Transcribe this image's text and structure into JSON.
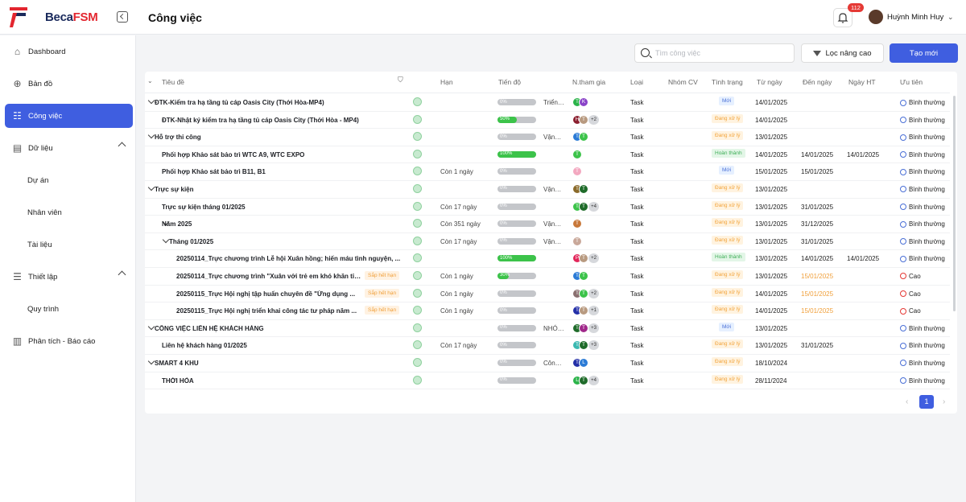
{
  "brand": {
    "name_a": "Beca",
    "name_b": "FSM"
  },
  "header": {
    "title": "Công việc",
    "notifications": "112",
    "user": "Huỳnh Minh Huy"
  },
  "sidebar": {
    "items": [
      {
        "label": "Dashboard"
      },
      {
        "label": "Bản đồ"
      },
      {
        "label": "Công việc"
      },
      {
        "label": "Dữ liệu"
      },
      {
        "label": "Dự án"
      },
      {
        "label": "Nhân viên"
      },
      {
        "label": "Tài liệu"
      },
      {
        "label": "Thiết lập"
      },
      {
        "label": "Quy trình"
      },
      {
        "label": "Phân tích - Báo cáo"
      }
    ]
  },
  "toolbar": {
    "search_placeholder": "Tìm công việc",
    "filter_label": "Lọc nâng cao",
    "create_label": "Tạo mới"
  },
  "table": {
    "headers": [
      "Tiêu đề",
      "Hạn",
      "Tiến độ",
      "N.tham gia",
      "Loại",
      "Nhóm CV",
      "Tình trạng",
      "Từ ngày",
      "Đến ngày",
      "Ngày HT",
      "Ưu tiên"
    ],
    "rows": [
      {
        "level": 0,
        "toggle": true,
        "title": "ĐTK-Kiểm tra hạ tầng tủ cáp Oasis City (Thới Hòa-MP4)",
        "due": "",
        "progress": 0,
        "progress_label": "0%",
        "extra": "Triển…",
        "avatars": [
          {
            "t": "T",
            "c": "#2bb34a"
          },
          {
            "t": "K",
            "c": "#8a44c8"
          }
        ],
        "more": "",
        "type": "Task",
        "status": "Mới",
        "status_kind": "new",
        "from": "14/01/2025",
        "to": "",
        "done": "",
        "priority": "Bình thường",
        "hi": false,
        "deadline": "",
        "late": false
      },
      {
        "level": 1,
        "toggle": false,
        "title": "ĐTK-Nhật ký kiểm tra hạ tầng tủ cáp Oasis City (Thới Hòa - MP4)",
        "due": "",
        "progress": 50,
        "progress_label": "50%",
        "extra": "",
        "avatars": [
          {
            "t": "H",
            "c": "#8b2030"
          },
          {
            "t": "T",
            "c": "#b89a80"
          }
        ],
        "more": "+2",
        "type": "Task",
        "status": "Đang xử lý",
        "status_kind": "doing",
        "from": "14/01/2025",
        "to": "",
        "done": "",
        "priority": "Bình thường",
        "hi": false,
        "deadline": "",
        "late": false
      },
      {
        "level": 0,
        "toggle": true,
        "title": "Hỗ trợ thi công",
        "due": "",
        "progress": 0,
        "progress_label": "0%",
        "extra": "Vận…",
        "avatars": [
          {
            "t": "T",
            "c": "#2b7bd6"
          },
          {
            "t": "T",
            "c": "#3cc34a"
          }
        ],
        "more": "",
        "type": "Task",
        "status": "Đang xử lý",
        "status_kind": "doing",
        "from": "13/01/2025",
        "to": "",
        "done": "",
        "priority": "Bình thường",
        "hi": false,
        "deadline": "",
        "late": false
      },
      {
        "level": 1,
        "toggle": false,
        "title": "Phối hợp Khảo sát bảo trì WTC A9, WTC EXPO",
        "due": "",
        "progress": 100,
        "progress_label": "100%",
        "extra": "",
        "avatars": [
          {
            "t": "T",
            "c": "#3cc34a"
          }
        ],
        "more": "",
        "type": "Task",
        "status": "Hoàn thành",
        "status_kind": "done",
        "from": "14/01/2025",
        "to": "14/01/2025",
        "done": "14/01/2025",
        "priority": "Bình thường",
        "hi": false,
        "deadline": "",
        "late": false
      },
      {
        "level": 1,
        "toggle": false,
        "title": "Phối hợp Khảo sát bảo trì B11, B1",
        "due": "Còn 1 ngày",
        "progress": 0,
        "progress_label": "0%",
        "extra": "",
        "avatars": [
          {
            "t": "T",
            "c": "#f3a8c0"
          }
        ],
        "more": "",
        "type": "Task",
        "status": "Mới",
        "status_kind": "new",
        "from": "15/01/2025",
        "to": "15/01/2025",
        "done": "",
        "priority": "Bình thường",
        "hi": false,
        "deadline": "",
        "late": false
      },
      {
        "level": 0,
        "toggle": true,
        "title": "Trực sự kiện",
        "due": "",
        "progress": 0,
        "progress_label": "0%",
        "extra": "Vận…",
        "avatars": [
          {
            "t": "T",
            "c": "#8a6a2a"
          },
          {
            "t": "T",
            "c": "#1f6b2a"
          }
        ],
        "more": "",
        "type": "Task",
        "status": "Đang xử lý",
        "status_kind": "doing",
        "from": "13/01/2025",
        "to": "",
        "done": "",
        "priority": "Bình thường",
        "hi": false,
        "deadline": "",
        "late": false
      },
      {
        "level": 1,
        "toggle": false,
        "title": "Trực sự kiện tháng 01/2025",
        "due": "Còn 17 ngày",
        "progress": 0,
        "progress_label": "0%",
        "extra": "",
        "avatars": [
          {
            "t": "T",
            "c": "#3cc34a"
          },
          {
            "t": "T",
            "c": "#1f6b2a"
          }
        ],
        "more": "+4",
        "type": "Task",
        "status": "Đang xử lý",
        "status_kind": "doing",
        "from": "13/01/2025",
        "to": "31/01/2025",
        "done": "",
        "priority": "Bình thường",
        "hi": false,
        "deadline": "",
        "late": false
      },
      {
        "level": 1,
        "toggle": true,
        "title": "Năm 2025",
        "due": "Còn 351 ngày",
        "progress": 0,
        "progress_label": "0%",
        "extra": "Vận…",
        "avatars": [
          {
            "t": "T",
            "c": "#c8783a"
          }
        ],
        "more": "",
        "type": "Task",
        "status": "Đang xử lý",
        "status_kind": "doing",
        "from": "13/01/2025",
        "to": "31/12/2025",
        "done": "",
        "priority": "Bình thường",
        "hi": false,
        "deadline": "",
        "late": false
      },
      {
        "level": 2,
        "toggle": true,
        "title": "Tháng 01/2025",
        "due": "Còn 17 ngày",
        "progress": 0,
        "progress_label": "0%",
        "extra": "Vận…",
        "avatars": [
          {
            "t": "T",
            "c": "#c9a89a"
          }
        ],
        "more": "",
        "type": "Task",
        "status": "Đang xử lý",
        "status_kind": "doing",
        "from": "13/01/2025",
        "to": "31/01/2025",
        "done": "",
        "priority": "Bình thường",
        "hi": false,
        "deadline": "",
        "late": false
      },
      {
        "level": 3,
        "toggle": false,
        "title": "20250114_Trực chương trình Lễ hội Xuân hồng; hiến máu tình nguyện, ...",
        "due": "",
        "progress": 100,
        "progress_label": "100%",
        "extra": "",
        "avatars": [
          {
            "t": "P",
            "c": "#e2265a"
          },
          {
            "t": "T",
            "c": "#b89a80"
          }
        ],
        "more": "+2",
        "type": "Task",
        "status": "Hoàn thành",
        "status_kind": "done",
        "from": "13/01/2025",
        "to": "14/01/2025",
        "done": "14/01/2025",
        "priority": "Bình thường",
        "hi": false,
        "deadline": "",
        "late": false
      },
      {
        "level": 3,
        "toggle": false,
        "title": "20250114_Trực chương trình \"Xuân với trẻ em khó khăn tỉn...",
        "due": "Còn 1 ngày",
        "progress": 30,
        "progress_label": "30%",
        "extra": "",
        "avatars": [
          {
            "t": "T",
            "c": "#2b7bd6"
          },
          {
            "t": "T",
            "c": "#3cc34a"
          }
        ],
        "more": "",
        "type": "Task",
        "status": "Đang xử lý",
        "status_kind": "doing",
        "from": "13/01/2025",
        "to": "15/01/2025",
        "done": "",
        "priority": "Cao",
        "hi": true,
        "deadline": "Sắp hết hạn",
        "late": true
      },
      {
        "level": 3,
        "toggle": false,
        "title": "20250115_Trực Hội nghị tập huấn chuyên đề \"Ứng dụng ...",
        "due": "Còn 1 ngày",
        "progress": 0,
        "progress_label": "0%",
        "extra": "",
        "avatars": [
          {
            "t": "T",
            "c": "#8a7070"
          },
          {
            "t": "T",
            "c": "#3cc34a"
          }
        ],
        "more": "+2",
        "type": "Task",
        "status": "Đang xử lý",
        "status_kind": "doing",
        "from": "14/01/2025",
        "to": "15/01/2025",
        "done": "",
        "priority": "Cao",
        "hi": true,
        "deadline": "Sắp hết hạn",
        "late": true
      },
      {
        "level": 3,
        "toggle": false,
        "title": "20250115_Trực Hội nghị triển khai công tác tư pháp năm ...",
        "due": "Còn 1 ngày",
        "progress": 0,
        "progress_label": "0%",
        "extra": "",
        "avatars": [
          {
            "t": "T",
            "c": "#2430a8"
          },
          {
            "t": "T",
            "c": "#b89a80"
          }
        ],
        "more": "+1",
        "type": "Task",
        "status": "Đang xử lý",
        "status_kind": "doing",
        "from": "14/01/2025",
        "to": "15/01/2025",
        "done": "",
        "priority": "Cao",
        "hi": true,
        "deadline": "Sắp hết hạn",
        "late": true
      },
      {
        "level": 0,
        "toggle": true,
        "title": "CÔNG VIỆC LIÊN HỆ KHÁCH HÀNG",
        "due": "",
        "progress": 0,
        "progress_label": "0%",
        "extra": "NHÓ…",
        "avatars": [
          {
            "t": "T",
            "c": "#1f6b2a"
          },
          {
            "t": "T",
            "c": "#a0288a"
          }
        ],
        "more": "+3",
        "type": "Task",
        "status": "Mới",
        "status_kind": "new",
        "from": "13/01/2025",
        "to": "",
        "done": "",
        "priority": "Bình thường",
        "hi": false,
        "deadline": "",
        "late": false
      },
      {
        "level": 1,
        "toggle": false,
        "title": "Liên hệ khách hàng 01/2025",
        "due": "Còn 17 ngày",
        "progress": 0,
        "progress_label": "0%",
        "extra": "",
        "avatars": [
          {
            "t": "T",
            "c": "#3ab8b0"
          },
          {
            "t": "T",
            "c": "#1f6b2a"
          }
        ],
        "more": "+3",
        "type": "Task",
        "status": "Đang xử lý",
        "status_kind": "doing",
        "from": "13/01/2025",
        "to": "31/01/2025",
        "done": "",
        "priority": "Bình thường",
        "hi": false,
        "deadline": "",
        "late": false
      },
      {
        "level": 0,
        "toggle": true,
        "title": "SMART 4 KHU",
        "due": "",
        "progress": 0,
        "progress_label": "0%",
        "extra": "Côn…",
        "avatars": [
          {
            "t": "T",
            "c": "#2430a8"
          },
          {
            "t": "L",
            "c": "#2b7bd6"
          }
        ],
        "more": "",
        "type": "Task",
        "status": "Đang xử lý",
        "status_kind": "doing",
        "from": "18/10/2024",
        "to": "",
        "done": "",
        "priority": "Bình thường",
        "hi": false,
        "deadline": "",
        "late": false
      },
      {
        "level": 1,
        "toggle": false,
        "title": "THỚI HÒA",
        "due": "",
        "progress": 0,
        "progress_label": "0%",
        "extra": "",
        "avatars": [
          {
            "t": "L",
            "c": "#2bb34a"
          },
          {
            "t": "T",
            "c": "#1f6b2a"
          }
        ],
        "more": "+4",
        "type": "Task",
        "status": "Đang xử lý",
        "status_kind": "doing",
        "from": "28/11/2024",
        "to": "",
        "done": "",
        "priority": "Bình thường",
        "hi": false,
        "deadline": "",
        "late": false
      }
    ]
  },
  "pagination": {
    "current": "1",
    "prev": "‹",
    "next": "›"
  }
}
